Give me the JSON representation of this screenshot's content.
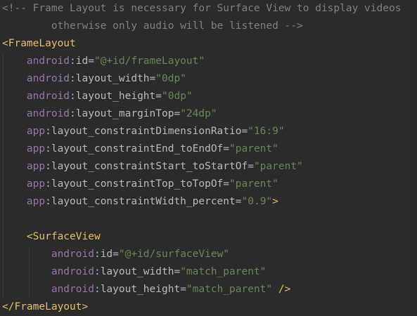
{
  "comment": {
    "line1": "<!-- Frame Layout is necessary for Surface View to display videos",
    "line2": "otherwise only audio will be listened -->"
  },
  "frame_layout": {
    "open": "<FrameLayout",
    "attributes": [
      {
        "ns": "android",
        "name": "id",
        "value": "\"@+id/frameLayout\""
      },
      {
        "ns": "android",
        "name": "layout_width",
        "value": "\"0dp\""
      },
      {
        "ns": "android",
        "name": "layout_height",
        "value": "\"0dp\""
      },
      {
        "ns": "android",
        "name": "layout_marginTop",
        "value": "\"24dp\""
      },
      {
        "ns": "app",
        "name": "layout_constraintDimensionRatio",
        "value": "\"16:9\""
      },
      {
        "ns": "app",
        "name": "layout_constraintEnd_toEndOf",
        "value": "\"parent\""
      },
      {
        "ns": "app",
        "name": "layout_constraintStart_toStartOf",
        "value": "\"parent\""
      },
      {
        "ns": "app",
        "name": "layout_constraintTop_toTopOf",
        "value": "\"parent\""
      },
      {
        "ns": "app",
        "name": "layout_constraintWidth_percent",
        "value": "\"0.9\""
      }
    ],
    "open_end": ">",
    "close": "</FrameLayout>"
  },
  "surface_view": {
    "open": "<SurfaceView",
    "attributes": [
      {
        "ns": "android",
        "name": "id",
        "value": "\"@+id/surfaceView\""
      },
      {
        "ns": "android",
        "name": "layout_width",
        "value": "\"match_parent\""
      },
      {
        "ns": "android",
        "name": "layout_height",
        "value": "\"match_parent\""
      }
    ],
    "self_close": " />"
  },
  "syntax": {
    "colon": ":",
    "equals": "="
  },
  "colors": {
    "background": "#2b2b2b",
    "comment": "#808080",
    "tag": "#e8bf6a",
    "namespace": "#9876aa",
    "attribute": "#bababa",
    "value": "#6a8759"
  }
}
